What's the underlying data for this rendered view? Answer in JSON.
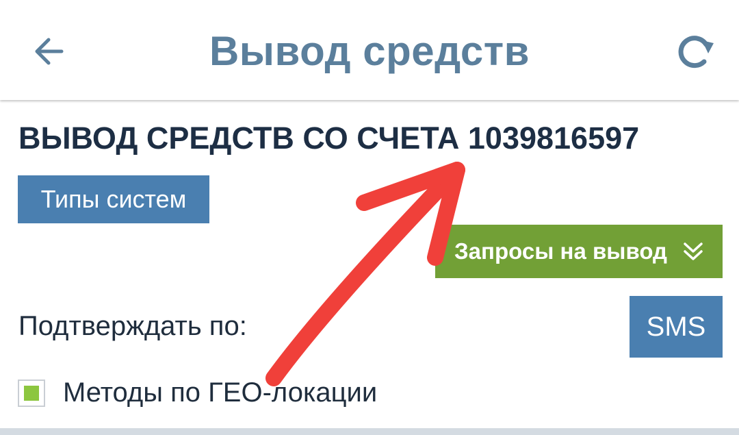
{
  "appbar": {
    "title": "Вывод средств",
    "back_icon": "arrow-left-icon",
    "refresh_icon": "refresh-icon",
    "title_color": "#5b7f9c"
  },
  "main": {
    "heading": "ВЫВОД СРЕДСТВ СО СЧЕТА 1039816597",
    "types_button": "Типы систем",
    "requests_button": "Запросы на вывод",
    "requests_icon": "chevron-double-down-icon",
    "confirm_label": "Подтверждать по:",
    "confirm_method": "SMS",
    "geo_checkbox_label": "Методы по ГЕО-локации",
    "geo_checkbox_checked": true
  },
  "colors": {
    "primary_blue": "#4a7fb0",
    "accent_green": "#72a036",
    "checkbox_green": "#8cc63f",
    "annotation_red": "#f0403a"
  },
  "annotation": {
    "type": "hand-drawn-arrow",
    "points_to": "account-number"
  }
}
